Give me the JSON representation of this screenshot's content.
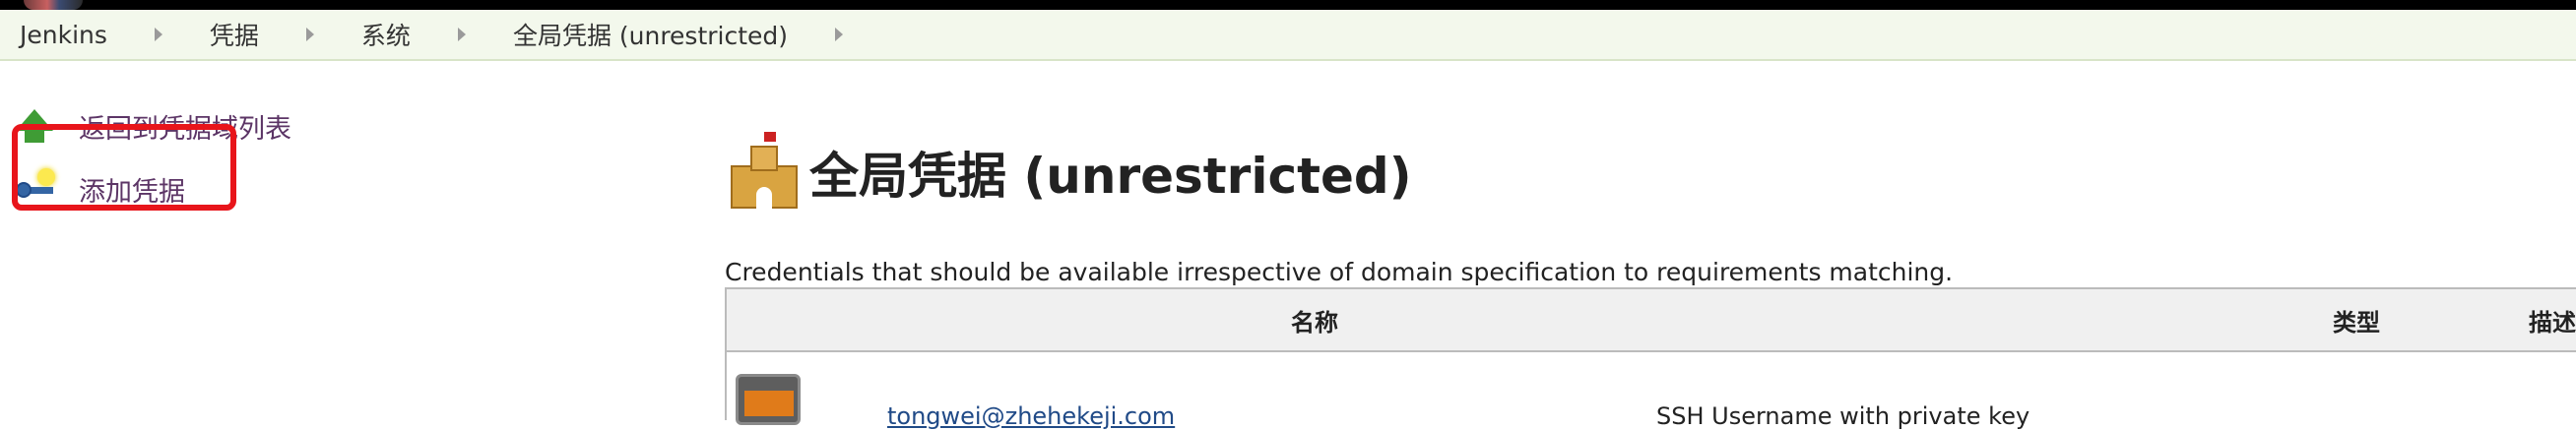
{
  "breadcrumb": {
    "items": [
      "Jenkins",
      "凭据",
      "系统",
      "全局凭据 (unrestricted)"
    ]
  },
  "side_panel": {
    "tasks": [
      {
        "label": "返回到凭据域列表",
        "icon": "up-arrow-icon"
      },
      {
        "label": "添加凭据",
        "icon": "key-add-icon"
      }
    ],
    "highlight_color": "#e8151b"
  },
  "main": {
    "title": "全局凭据 (unrestricted)",
    "title_icon": "castle-icon",
    "description": "Credentials that should be available irrespective of domain specification to requirements matching."
  },
  "table": {
    "headers": [
      "名称",
      "类型",
      "描述"
    ],
    "rows": [
      {
        "icon": "credential-icon",
        "name": "tongwei@zhehekeji.com",
        "type": "SSH Username with private key",
        "description": ""
      }
    ]
  },
  "colors": {
    "breadcrumb_bg": "#f3f8ec",
    "link": "#5c3566",
    "top_strip": "#000000"
  }
}
